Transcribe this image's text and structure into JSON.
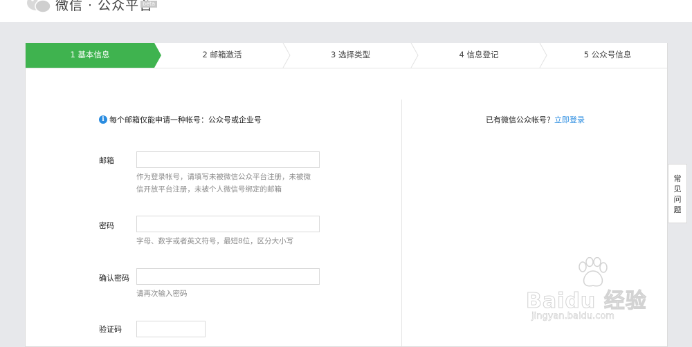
{
  "header": {
    "app_name": "微信 · 公众平台",
    "beta_badge": "beta"
  },
  "steps": [
    {
      "label": "1 基本信息",
      "active": true
    },
    {
      "label": "2 邮箱激活",
      "active": false
    },
    {
      "label": "3 选择类型",
      "active": false
    },
    {
      "label": "4 信息登记",
      "active": false
    },
    {
      "label": "5 公众号信息",
      "active": false
    }
  ],
  "form": {
    "notice": "每个邮箱仅能申请一种帐号：公众号或企业号",
    "email": {
      "label": "邮箱",
      "value": "",
      "hint": "作为登录帐号，请填写未被微信公众平台注册，未被微信开放平台注册，未被个人微信号绑定的邮箱"
    },
    "password": {
      "label": "密码",
      "value": "",
      "hint": "字母、数字或者英文符号，最短8位，区分大小写"
    },
    "confirm_password": {
      "label": "确认密码",
      "value": "",
      "hint": "请再次输入密码"
    },
    "captcha": {
      "label": "验证码",
      "value": ""
    }
  },
  "login": {
    "prompt": "已有微信公众帐号？",
    "link": "立即登录"
  },
  "faq": {
    "chars": [
      "常",
      "见",
      "问",
      "题"
    ]
  },
  "watermark": {
    "brand": "Bai",
    "brand2": "du",
    "product": "经验",
    "url": "jingyan.baidu.com"
  },
  "colors": {
    "accent_green": "#3fb34f",
    "link_blue": "#2a8ce0",
    "page_bg": "#e7e8eb"
  },
  "icons": {
    "logo": "wechat-logo-icon",
    "info": "info-icon"
  }
}
